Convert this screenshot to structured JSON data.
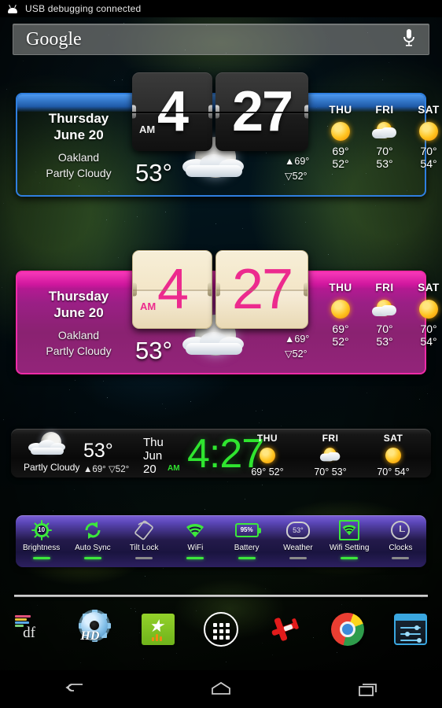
{
  "status_bar": {
    "icon": "android-robot-icon",
    "text": "USB debugging connected"
  },
  "search": {
    "label": "Google",
    "mic_icon": "microphone-icon"
  },
  "widgets": {
    "blue": {
      "accent": "#2a6fd6",
      "day": "Thursday",
      "date": "June 20",
      "city": "Oakland",
      "condition": "Partly Cloudy",
      "temp": "53°",
      "high": "▲69°",
      "low": "▽52°",
      "clock": {
        "hour": "4",
        "minute": "27",
        "ampm": "AM"
      },
      "weather_icon": "moon-behind-cloud-icon",
      "forecast": [
        {
          "day": "THU",
          "icon": "sunny-icon",
          "high": "69°",
          "low": "52°"
        },
        {
          "day": "FRI",
          "icon": "partly-cloudy-icon",
          "high": "70°",
          "low": "53°"
        },
        {
          "day": "SAT",
          "icon": "sunny-icon",
          "high": "70°",
          "low": "54°"
        }
      ]
    },
    "pink": {
      "accent": "#e0189b",
      "day": "Thursday",
      "date": "June 20",
      "city": "Oakland",
      "condition": "Partly Cloudy",
      "temp": "53°",
      "high": "▲69°",
      "low": "▽52°",
      "clock": {
        "hour": "4",
        "minute": "27",
        "ampm": "AM"
      },
      "weather_icon": "moon-behind-cloud-icon",
      "forecast": [
        {
          "day": "THU",
          "icon": "sunny-icon",
          "high": "69°",
          "low": "52°"
        },
        {
          "day": "FRI",
          "icon": "partly-cloudy-icon",
          "high": "70°",
          "low": "53°"
        },
        {
          "day": "SAT",
          "icon": "sunny-icon",
          "high": "70°",
          "low": "54°"
        }
      ]
    },
    "compact": {
      "accent": "#2fe52f",
      "condition": "Partly Cloudy",
      "temp": "53°",
      "hilo": "▲69°  ▽52°",
      "date": "Thu\nJun\n20",
      "ampm": "AM",
      "time": "4:27",
      "weather_icon": "moon-behind-cloud-icon",
      "forecast": [
        {
          "day": "THU",
          "icon": "sunny-icon",
          "temps": "69° 52°"
        },
        {
          "day": "FRI",
          "icon": "partly-cloudy-icon",
          "temps": "70° 53°"
        },
        {
          "day": "SAT",
          "icon": "sunny-icon",
          "temps": "70° 54°"
        }
      ]
    },
    "toggles": [
      {
        "label": "Brightness",
        "icon": "brightness-icon",
        "value": "10",
        "state": "on"
      },
      {
        "label": "Auto Sync",
        "icon": "sync-icon",
        "value": "",
        "state": "on"
      },
      {
        "label": "Tilt Lock",
        "icon": "rotation-lock-icon",
        "value": "",
        "state": "off"
      },
      {
        "label": "WiFi",
        "icon": "wifi-icon",
        "value": "",
        "state": "on"
      },
      {
        "label": "Battery",
        "icon": "battery-icon",
        "value": "95%",
        "state": "on"
      },
      {
        "label": "Weather",
        "icon": "weather-cloud-icon",
        "value": "53°",
        "state": "off"
      },
      {
        "label": "Wifi Setting",
        "icon": "wifi-settings-icon",
        "value": "",
        "state": "on"
      },
      {
        "label": "Clocks",
        "icon": "clock-icon",
        "value": "",
        "state": "off"
      }
    ]
  },
  "dock": [
    {
      "name": "df-app-icon",
      "label": "df"
    },
    {
      "name": "hd-widgets-icon",
      "label": "HD"
    },
    {
      "name": "play-store-icon",
      "label": ""
    },
    {
      "name": "app-drawer-icon",
      "label": ""
    },
    {
      "name": "airplane-mode-icon",
      "label": ""
    },
    {
      "name": "chrome-icon",
      "label": ""
    },
    {
      "name": "settings-icon",
      "label": ""
    }
  ],
  "navbar": [
    {
      "name": "back-button",
      "icon": "back-arrow-icon"
    },
    {
      "name": "home-button",
      "icon": "home-icon"
    },
    {
      "name": "recents-button",
      "icon": "recent-apps-icon"
    }
  ]
}
